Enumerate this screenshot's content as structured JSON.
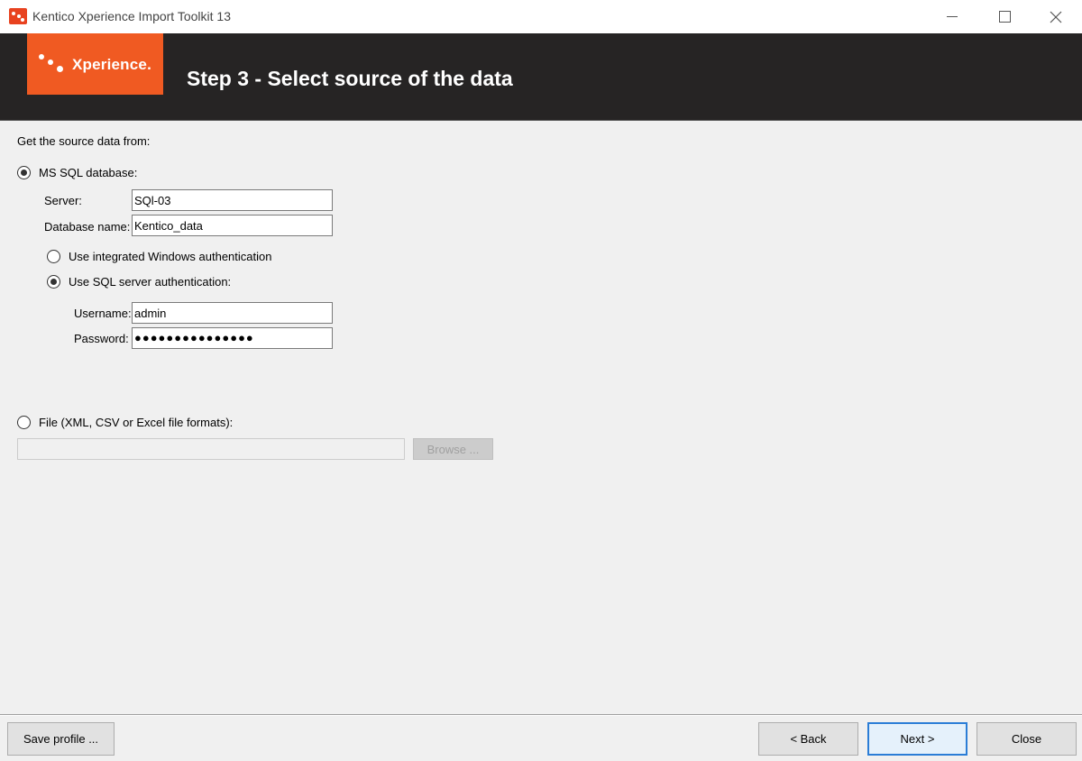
{
  "window": {
    "title": "Kentico Xperience Import Toolkit 13"
  },
  "banner": {
    "logo_text": "Xperience.",
    "step_title": "Step 3 - Select source of the data"
  },
  "form": {
    "source_label": "Get the source data from:",
    "sql_option": {
      "label": "MS SQL database:",
      "selected": true
    },
    "server_label": "Server:",
    "server_value": "SQl-03",
    "dbname_label": "Database name:",
    "dbname_value": "Kentico_data",
    "auth_windows": {
      "label": "Use integrated Windows authentication",
      "selected": false
    },
    "auth_sql": {
      "label": "Use SQL server authentication:",
      "selected": true
    },
    "username_label": "Username:",
    "username_value": "admin",
    "password_label": "Password:",
    "password_value": "●●●●●●●●●●●●●●●",
    "file_option": {
      "label": "File (XML, CSV or Excel file formats):",
      "selected": false
    },
    "file_path_value": "",
    "browse_label": "Browse ..."
  },
  "footer": {
    "save_profile": "Save profile ...",
    "back": "< Back",
    "next": "Next >",
    "close": "Close"
  },
  "colors": {
    "brand_orange": "#f05a22",
    "banner_bg": "#262424",
    "default_button_border": "#2b7dd6"
  }
}
